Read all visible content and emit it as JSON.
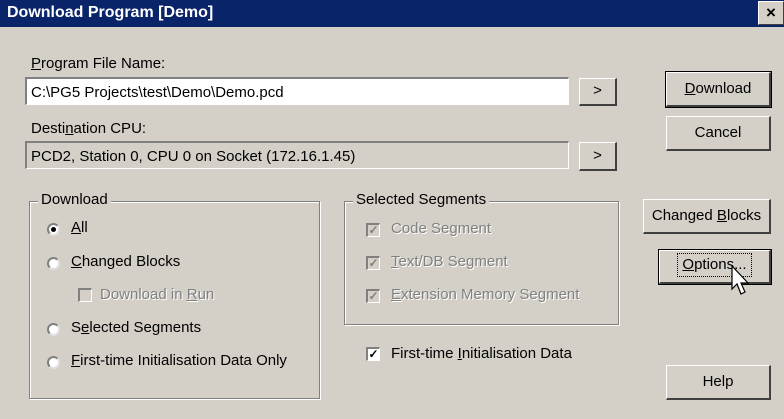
{
  "window": {
    "title": "Download Program [Demo]",
    "close_glyph": "×"
  },
  "program_file": {
    "label": "Program File Name:",
    "value": "C:\\PG5 Projects\\test\\Demo\\Demo.pcd",
    "browse_label": ">"
  },
  "destination": {
    "label": "Destination CPU:",
    "value": "PCD2, Station 0, CPU 0 on Socket (172.16.1.45)",
    "browse_label": ">"
  },
  "buttons": {
    "download": "Download",
    "cancel": "Cancel",
    "changed_blocks": "Changed Blocks",
    "options": "Options...",
    "help": "Help"
  },
  "download_group": {
    "title": "Download",
    "all": "All",
    "changed_blocks": "Changed Blocks",
    "download_in_run": "Download in Run",
    "selected_segments": "Selected Segments",
    "first_time": "First-time Initialisation Data Only",
    "selected": "All"
  },
  "segments_group": {
    "title": "Selected Segments",
    "code": "Code Segment",
    "text_db": "Text/DB Segment",
    "extension": "Extension Memory Segment"
  },
  "first_time_checkbox": {
    "label": "First-time Initialisation Data",
    "checked": true
  },
  "icons": {
    "cursor": "arrow-cursor-icon",
    "radio_dot": "radio-dot-icon"
  }
}
